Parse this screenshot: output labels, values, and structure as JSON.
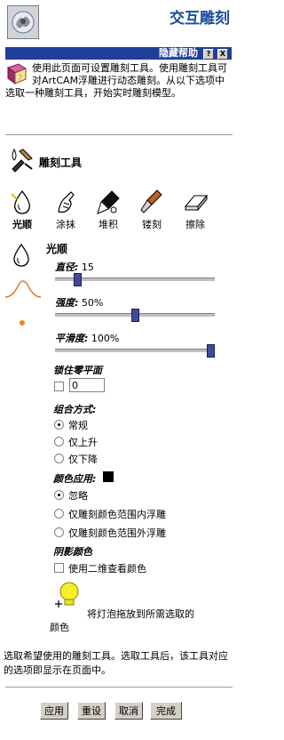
{
  "header": {
    "title": "交互雕刻"
  },
  "help": {
    "bar_label": "隐藏帮助",
    "question_btn": "?",
    "close_btn": "X",
    "text": "使用此页面可设置雕刻工具。使用雕刻工具可对ArtCAM浮雕进行动态雕刻。从以下选项中选取一种雕刻工具，开始实时雕刻模型。"
  },
  "section": {
    "title": "雕刻工具"
  },
  "tools": [
    {
      "label": "光顺",
      "icon": "smooth-drop-icon",
      "selected": true
    },
    {
      "label": "涂抹",
      "icon": "smudge-finger-icon",
      "selected": false
    },
    {
      "label": "堆积",
      "icon": "deposit-icon",
      "selected": false
    },
    {
      "label": "镂刻",
      "icon": "carve-chisel-icon",
      "selected": false
    },
    {
      "label": "擦除",
      "icon": "eraser-icon",
      "selected": false
    }
  ],
  "current_tool": {
    "name": "光顺"
  },
  "params": {
    "diameter_label": "直径:",
    "diameter_value": "15",
    "diameter_fraction": 0.12,
    "strength_label": "强度:",
    "strength_value": "50%",
    "strength_fraction": 0.5,
    "smoothness_label": "平滑度:",
    "smoothness_value": "100%",
    "smoothness_fraction": 1.0
  },
  "lock": {
    "label": "锁住零平面",
    "value": "0",
    "checked": false
  },
  "combine": {
    "label": "组合方式:",
    "options": [
      "常规",
      "仅上升",
      "仅下降"
    ],
    "selected": 0
  },
  "color_apply": {
    "label": "颜色应用:",
    "swatch": "#000000",
    "options": [
      "忽略",
      "仅雕刻颜色范围内浮雕",
      "仅雕刻颜色范围外浮雕"
    ],
    "selected": 0
  },
  "shade": {
    "label": "阴影颜色",
    "checkbox_label": "使用二维查看颜色",
    "checked": false
  },
  "bulb": {
    "caption": "颜色",
    "instruction": "将灯泡拖放到所需选取的"
  },
  "footer_text": "选取希望使用的雕刻工具。选取工具后，该工具对应的选项即显示在页面中。",
  "buttons": {
    "apply": "应用",
    "reset": "重设",
    "cancel": "取消",
    "done": "完成"
  },
  "colors": {
    "title": "#1c4e9b",
    "helpbar": "#1f3f9a",
    "slider_thumb": "#3f4b9a"
  }
}
